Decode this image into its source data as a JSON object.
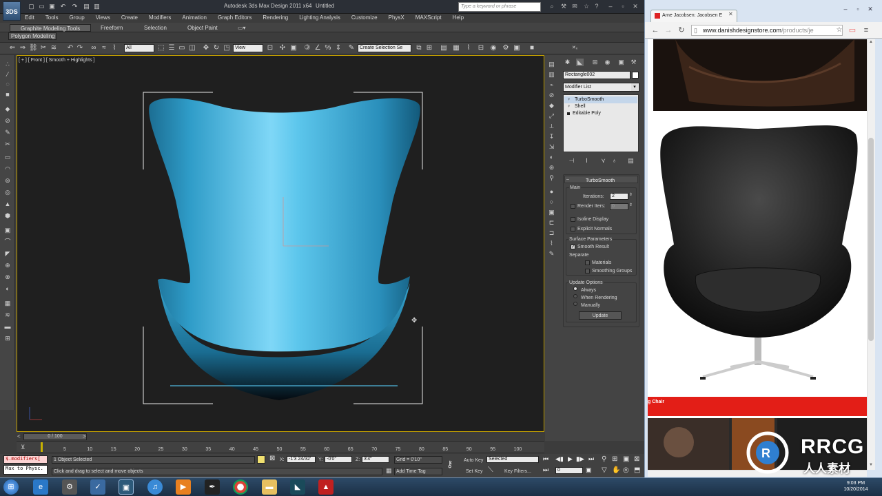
{
  "max": {
    "logo": "3DS",
    "app_title": "Autodesk 3ds Max Design 2011 x64",
    "doc_title": "Untitled",
    "search_placeholder": "Type a keyword or phrase",
    "menus": [
      "Edit",
      "Tools",
      "Group",
      "Views",
      "Create",
      "Modifiers",
      "Animation",
      "Graph Editors",
      "Rendering",
      "Lighting Analysis",
      "Customize",
      "PhysX",
      "MAXScript",
      "Help"
    ],
    "ribbon_tabs": [
      "Graphite Modeling Tools",
      "Freeform",
      "Selection",
      "Object Paint"
    ],
    "ribbon_subtab": "Polygon Modeling",
    "toolbar": {
      "filter": "All",
      "refcoord": "View",
      "named_selection": "Create Selection Se"
    },
    "viewport_label": "[ + ] [ Front ] [ Smooth + Highlights ]",
    "command_panel": {
      "object_name": "Rectangle002",
      "modifier_list": "Modifier List",
      "stack": [
        "TurboSmooth",
        "Shell",
        "Editable Poly"
      ],
      "turbosmooth": {
        "title": "TurboSmooth",
        "main_group": "Main",
        "iterations_label": "Iterations:",
        "iterations_value": "2",
        "render_iters_label": "Render Iters:",
        "render_iters_value": "0",
        "isoline": "Isoline Display",
        "explicit_normals": "Explicit Normals",
        "surface_group": "Surface Parameters",
        "smooth_result": "Smooth Result",
        "separate": "Separate",
        "materials": "Materials",
        "smoothing_groups": "Smoothing Groups",
        "update_group": "Update Options",
        "always": "Always",
        "when_rendering": "When Rendering",
        "manually": "Manually",
        "update_button": "Update"
      }
    },
    "timeslider": "0 / 100",
    "ticks": [
      "5",
      "10",
      "15",
      "20",
      "25",
      "30",
      "35",
      "40",
      "45",
      "50",
      "55",
      "60",
      "65",
      "70",
      "75",
      "80",
      "85",
      "90",
      "95",
      "100"
    ],
    "status": {
      "maxscript_line1": "$.modifiers[",
      "maxscript_line2": "Max to Physc.",
      "selected": "1 Object Selected",
      "prompt": "Click and drag to select and move objects",
      "x_label": "X:",
      "x_value": "-1'3 24/32'",
      "y_label": "Y:",
      "y_value": "-0'0\"",
      "z_label": "Z:",
      "z_value": "3'4\"",
      "grid": "Grid = 0'10\"",
      "add_time_tag": "Add Time Tag",
      "auto_key": "Auto Key",
      "auto_key_dropdown": "Selected",
      "set_key": "Set Key",
      "key_filters": "Key Filters...",
      "frame": "0"
    }
  },
  "browser": {
    "tab_title": "Arne Jacobsen: Jacobsen E",
    "url_host": "www.danishdesignstore.com",
    "url_path": "/products/je",
    "banner_text": "g Chair"
  },
  "watermark": {
    "big": "RRCG",
    "small": "人人素材"
  },
  "taskbar": {
    "time": "9:03 PM",
    "date": "10/20/2014"
  },
  "colors": {
    "viewport_bg": "#1f1f1f",
    "chair": "#3fb3de",
    "viewport_border": "#c8a400",
    "banner": "#e31e17"
  }
}
